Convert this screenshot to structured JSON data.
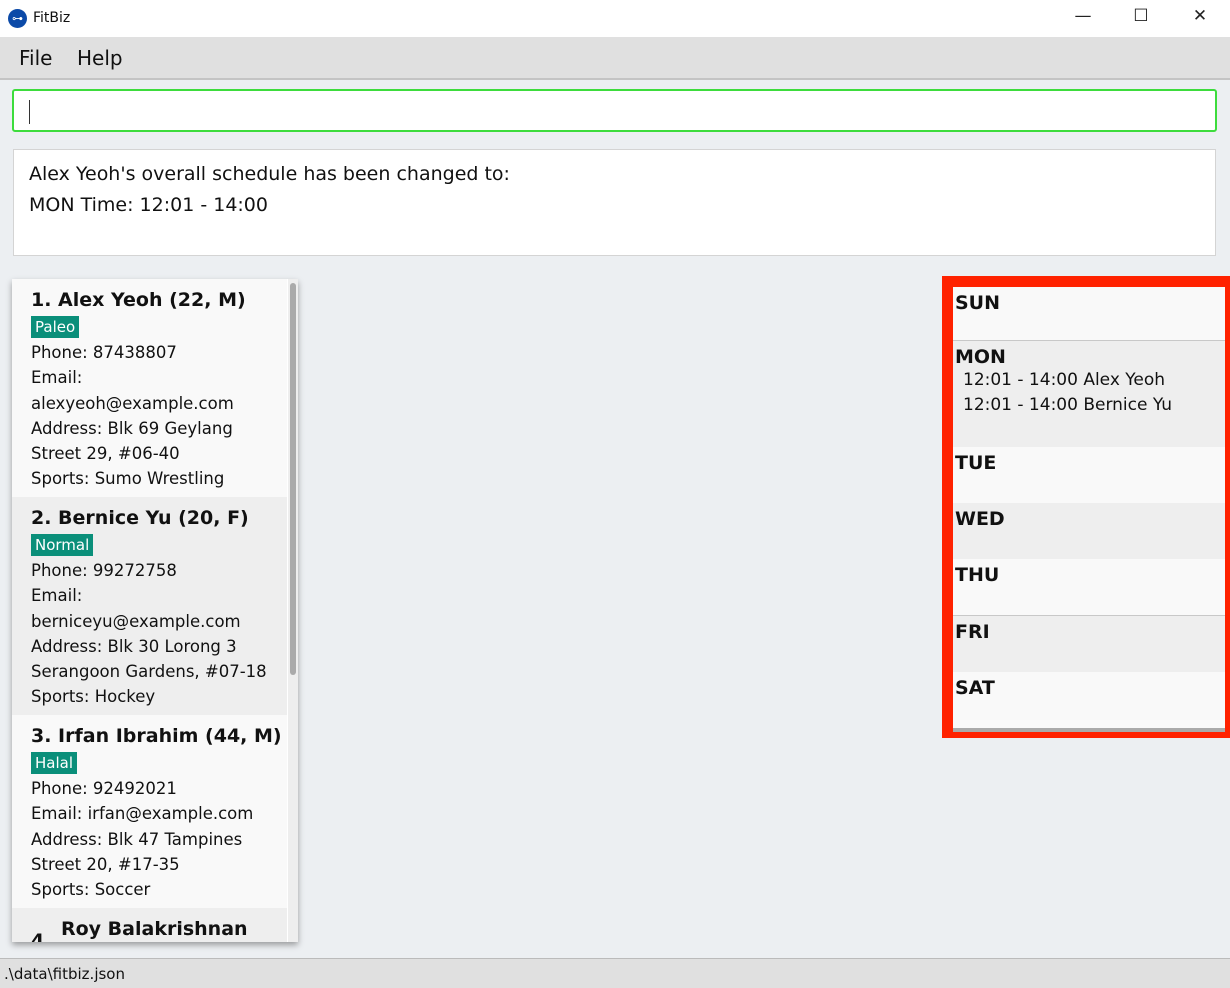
{
  "window": {
    "title": "FitBiz",
    "icon": "dumbbell-logo-icon"
  },
  "menu": [
    "File",
    "Help"
  ],
  "command": {
    "value": ""
  },
  "result": {
    "lines": [
      "Alex Yeoh's overall schedule has been changed to:",
      "MON Time: 12:01 - 14:00"
    ]
  },
  "persons": [
    {
      "name": "1.  Alex Yeoh (22, M)",
      "tag": "Paleo",
      "lines": [
        "Phone: 87438807",
        "Email:",
        "alexyeoh@example.com",
        "Address: Blk 69 Geylang",
        "Street 29, #06-40",
        "Sports: Sumo Wrestling"
      ]
    },
    {
      "name": "2.  Bernice Yu (20, F)",
      "tag": "Normal",
      "lines": [
        "Phone: 99272758",
        "Email:",
        "berniceyu@example.com",
        "Address: Blk 30 Lorong 3",
        "Serangoon Gardens, #07-18",
        "Sports: Hockey"
      ]
    },
    {
      "name": "3.  Irfan Ibrahim (44, M)",
      "tag": "Halal",
      "lines": [
        "Phone: 92492021",
        "Email: irfan@example.com",
        "Address: Blk 47 Tampines",
        "Street 20, #17-35",
        "Sports: Soccer"
      ]
    },
    {
      "name": "Roy Balakrishnan",
      "index": "4."
    }
  ],
  "schedule": [
    {
      "day": "SUN",
      "events": []
    },
    {
      "day": "MON",
      "events": [
        "12:01 - 14:00 Alex Yeoh",
        "12:01 - 14:00 Bernice Yu"
      ]
    },
    {
      "day": "TUE",
      "events": []
    },
    {
      "day": "WED",
      "events": []
    },
    {
      "day": "THU",
      "events": []
    },
    {
      "day": "FRI",
      "events": []
    },
    {
      "day": "SAT",
      "events": []
    }
  ],
  "status": {
    "path": ".\\data\\fitbiz.json"
  },
  "colors": {
    "highlight": "#ff2200",
    "tag": "#0a8f7a",
    "command_border": "#3ddc3d"
  }
}
